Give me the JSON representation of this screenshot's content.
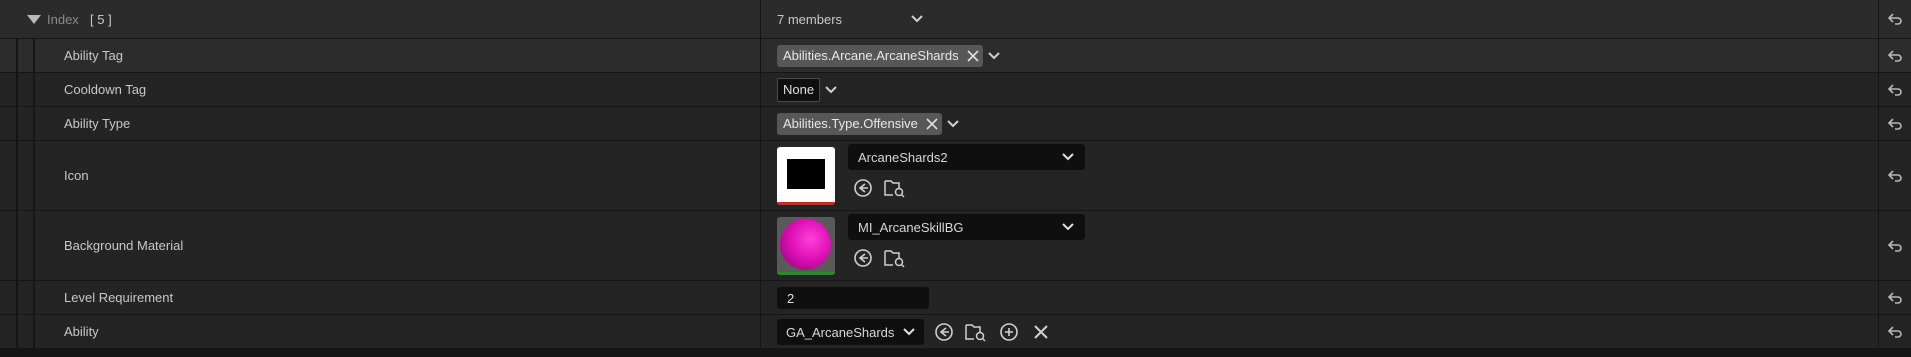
{
  "header": {
    "label": "Index",
    "index_bracket": "[ 5 ]",
    "value": "7 members"
  },
  "rows": {
    "ability_tag": {
      "label": "Ability Tag",
      "value": "Abilities.Arcane.ArcaneShards"
    },
    "cooldown_tag": {
      "label": "Cooldown Tag",
      "value": "None"
    },
    "ability_type": {
      "label": "Ability Type",
      "value": "Abilities.Type.Offensive"
    },
    "icon": {
      "label": "Icon",
      "asset": "ArcaneShards2"
    },
    "background_material": {
      "label": "Background Material",
      "asset": "MI_ArcaneSkillBG"
    },
    "level_requirement": {
      "label": "Level Requirement",
      "value": "2"
    },
    "ability": {
      "label": "Ability",
      "value": "GA_ArcaneShards"
    }
  },
  "colors": {
    "background": "#242424",
    "header_background": "#2b2b2b",
    "chip": "#575757",
    "field": "#0f0f0f",
    "material_swatch": "#e010b8"
  },
  "icons": [
    "triangle-down-icon",
    "chevron-down-icon",
    "close-icon",
    "reset-to-default-icon",
    "use-selected-icon",
    "browse-asset-icon",
    "add-icon"
  ]
}
